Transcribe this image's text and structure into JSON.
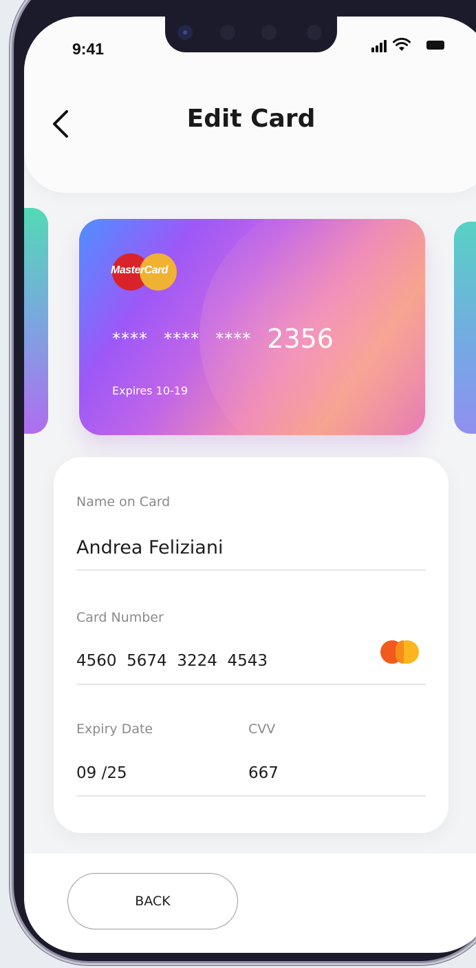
{
  "status_bar": {
    "time": "9:41"
  },
  "header": {
    "title": "Edit Card"
  },
  "card": {
    "brand": "MasterCard",
    "number_mask": [
      "****",
      "****",
      "****"
    ],
    "last_four": "2356",
    "expires": "Expires 10-19"
  },
  "form": {
    "name_label": "Name on Card",
    "name_value": "Andrea Feliziani",
    "number_label": "Card Number",
    "number_value": "4560  5674  3224  4543",
    "expiry_label": "Expiry Date",
    "expiry_value": "09 /25",
    "cvv_label": "CVV",
    "cvv_value": "667"
  },
  "footer": {
    "back_label": "BACK"
  },
  "colors": {
    "background": "#e9edf1",
    "phone_frame": "#1c1b2b",
    "title": "#1a1a1a",
    "label": "#8a8a8a",
    "mastercard_red": "#d8232a",
    "mastercard_yellow": "#f0b233"
  },
  "icons": [
    "back-chevron-icon",
    "signal-icon",
    "wifi-icon",
    "battery-icon",
    "mastercard-logo-icon"
  ]
}
